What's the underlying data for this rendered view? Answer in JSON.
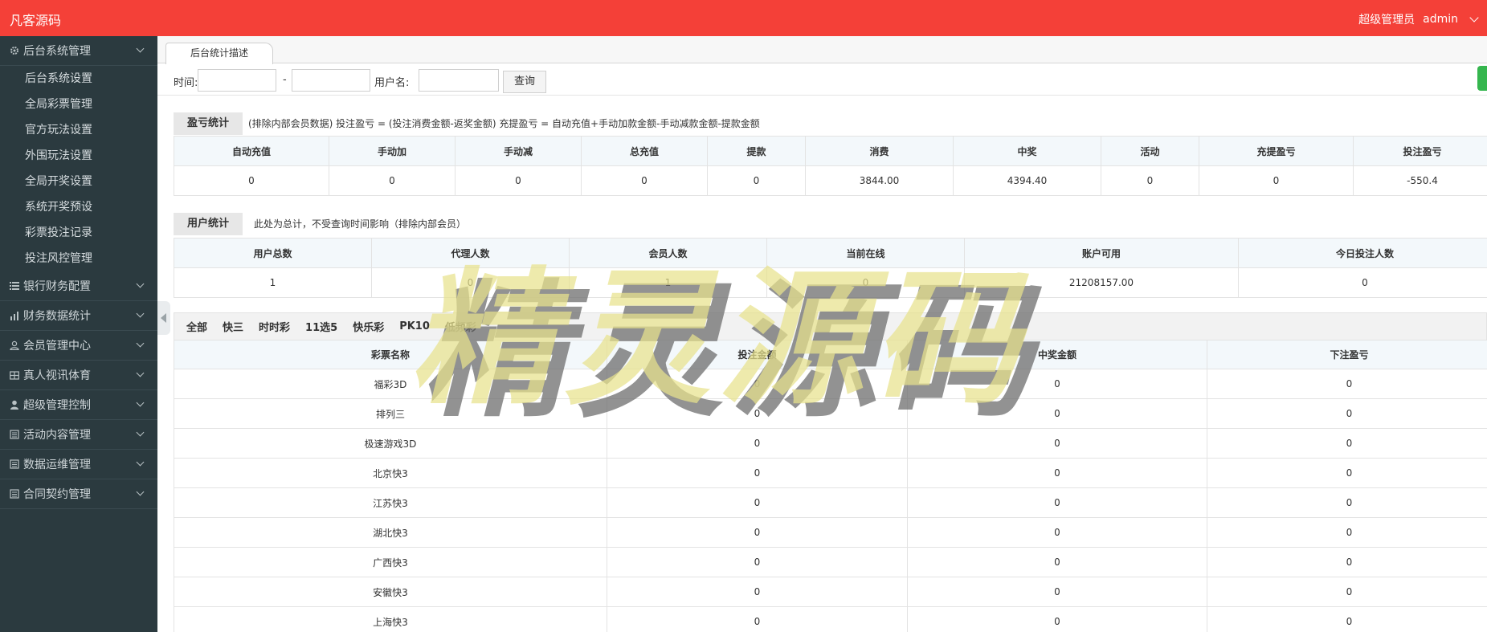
{
  "header": {
    "brand": "凡客源码",
    "role": "超级管理员",
    "username": "admin"
  },
  "sidebar": {
    "groups": [
      {
        "label": "后台系统管理",
        "icon": "gear-icon",
        "expanded": true,
        "items": [
          "后台系统设置",
          "全局彩票管理",
          "官方玩法设置",
          "外围玩法设置",
          "全局开奖设置",
          "系统开奖预设",
          "彩票投注记录",
          "投注风控管理"
        ]
      },
      {
        "label": "银行财务配置",
        "icon": "list-icon"
      },
      {
        "label": "财务数据统计",
        "icon": "bar-chart-icon"
      },
      {
        "label": "会员管理中心",
        "icon": "user-outline-icon"
      },
      {
        "label": "真人视讯体育",
        "icon": "grid-box-icon"
      },
      {
        "label": "超级管理控制",
        "icon": "user-solid-icon"
      },
      {
        "label": "活动内容管理",
        "icon": "document-icon"
      },
      {
        "label": "数据运维管理",
        "icon": "document-icon"
      },
      {
        "label": "合同契约管理",
        "icon": "document-icon"
      }
    ]
  },
  "tabs": {
    "active": "后台统计描述"
  },
  "filter": {
    "time_label": "时间:",
    "separator": "-",
    "username_label": "用户名:",
    "start": "",
    "end": "",
    "username": "",
    "query_button": "查询"
  },
  "profit": {
    "tag": "盈亏统计",
    "note": "(排除内部会员数据)  投注盈亏 = (投注消费金额-返奖金额)     充提盈亏 = 自动充值+手动加款金额-手动减款金额-提款金额",
    "headers": [
      "自动充值",
      "手动加",
      "手动减",
      "总充值",
      "提款",
      "消费",
      "中奖",
      "活动",
      "充提盈亏",
      "投注盈亏"
    ],
    "values": [
      "0",
      "0",
      "0",
      "0",
      "0",
      "3844.00",
      "4394.40",
      "0",
      "0",
      "-550.4"
    ]
  },
  "users": {
    "tag": "用户统计",
    "note": "此处为总计，不受查询时间影响（排除内部会员）",
    "headers": [
      "用户总数",
      "代理人数",
      "会员人数",
      "当前在线",
      "账户可用",
      "今日投注人数"
    ],
    "values": [
      "1",
      "0",
      "1",
      "0",
      "21208157.00",
      "0"
    ]
  },
  "lottery": {
    "tabs": [
      "全部",
      "快三",
      "时时彩",
      "11选5",
      "快乐彩",
      "PK10",
      "低频彩"
    ],
    "headers": [
      "彩票名称",
      "投注金额",
      "中奖金额",
      "下注盈亏"
    ],
    "rows": [
      [
        "福彩3D",
        "0",
        "0",
        "0"
      ],
      [
        "排列三",
        "0",
        "0",
        "0"
      ],
      [
        "极速游戏3D",
        "0",
        "0",
        "0"
      ],
      [
        "北京快3",
        "0",
        "0",
        "0"
      ],
      [
        "江苏快3",
        "0",
        "0",
        "0"
      ],
      [
        "湖北快3",
        "0",
        "0",
        "0"
      ],
      [
        "广西快3",
        "0",
        "0",
        "0"
      ],
      [
        "安徽快3",
        "0",
        "0",
        "0"
      ],
      [
        "上海快3",
        "0",
        "0",
        "0"
      ]
    ]
  },
  "watermark": "精灵源码",
  "colors": {
    "header": "#f44038",
    "sidebar": "#2b3a3f",
    "table_header": "#f3f8fb",
    "accent_green": "#35b64e"
  }
}
